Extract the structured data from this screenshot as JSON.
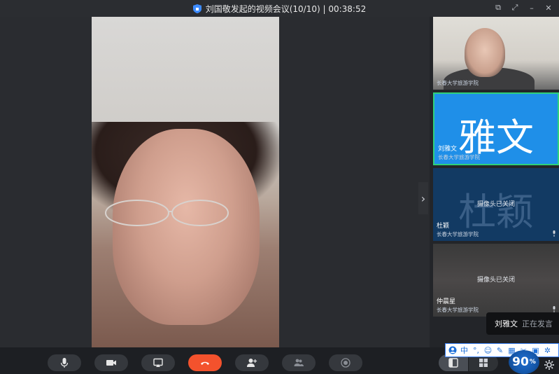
{
  "window": {
    "title": "刘国敬发起的视频会议(10/10) | 00:38:52"
  },
  "participants": [
    {
      "name": "",
      "org": "长春大学旅游学院",
      "camera_off_text": "",
      "avatar_text": ""
    },
    {
      "name": "刘雅文",
      "org": "长春大学旅游学院",
      "camera_off_text": "",
      "avatar_text": "雅文"
    },
    {
      "name": "杜颖",
      "org": "长春大学旅游学院",
      "camera_off_text": "摄像头已关闭",
      "avatar_text": "杜颖"
    },
    {
      "name": "仲晨星",
      "org": "长春大学旅游学院",
      "camera_off_text": "摄像头已关闭",
      "avatar_text": ""
    }
  ],
  "speaking_toast": {
    "name": "刘雅文",
    "status": "正在发言"
  },
  "ime_bar": {
    "mode": "中"
  },
  "gauge": {
    "value": "90",
    "unit": "%"
  },
  "colors": {
    "hangup": "#f3522d",
    "active_speaker_border": "#2fd07a",
    "avatar_blue": "#1f8fe8"
  }
}
